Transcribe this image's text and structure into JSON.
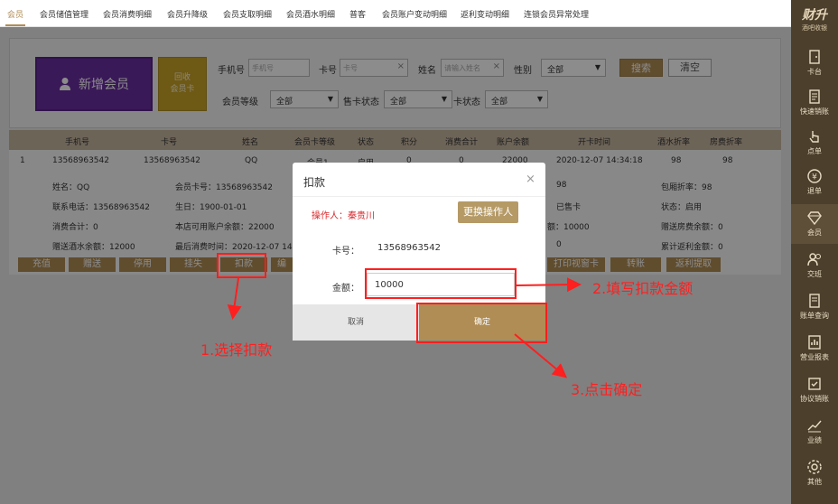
{
  "tabs": [
    {
      "label": "会员",
      "active": true
    },
    {
      "label": "会员储值管理"
    },
    {
      "label": "会员消费明细"
    },
    {
      "label": "会员升降级"
    },
    {
      "label": "会员支取明细"
    },
    {
      "label": "会员酒水明细"
    },
    {
      "label": "普客"
    },
    {
      "label": "会员账户变动明细"
    },
    {
      "label": "返利变动明细"
    },
    {
      "label": "连锁会员异常处理"
    }
  ],
  "search": {
    "new_member_label": "新增会员",
    "recycle_line1": "回收",
    "recycle_line2": "会员卡",
    "phone_label": "手机号",
    "phone_placeholder": "手机号",
    "card_label": "卡号",
    "card_placeholder": "卡号",
    "name_label": "姓名",
    "name_placeholder": "请输入姓名",
    "gender_label": "性别",
    "gender_value": "全部",
    "level_label": "会员等级",
    "level_value": "全部",
    "sale_status_label": "售卡状态",
    "sale_status_value": "全部",
    "card_status_label": "卡状态",
    "card_status_value": "全部",
    "search_btn": "搜索",
    "clear_btn": "清空"
  },
  "table": {
    "headers": [
      "手机号",
      "卡号",
      "姓名",
      "会员卡等级",
      "状态",
      "积分",
      "消费合计",
      "账户余额",
      "开卡时间",
      "酒水折率",
      "房费折率"
    ],
    "row": [
      "1",
      "13568963542",
      "13568963542",
      "QQ",
      "会员1",
      "启用",
      "0",
      "0",
      "22000",
      "2020-12-07 14:34:18",
      "98",
      "98"
    ]
  },
  "detail": {
    "name": "姓名：QQ",
    "card_no": "会员卡号：13568963542",
    "room_discount": "包厢折率：98",
    "phone": "联系电话：13568963542",
    "birthday": "生日：1900-01-01",
    "sold": "已售卡",
    "status": "状态：启用",
    "consume": "消费合计：0",
    "available": "本店可用账户余额：22000",
    "balance_tail": "额：10000",
    "gift_room": "赠送房费余额：0",
    "gift_wine": "赠送酒水余额：12000",
    "last_consume": "最后消费时间：2020-12-07 14:",
    "points_tail": "0",
    "rebate": "累计返利金额：0",
    "extra_98": "98"
  },
  "actions": [
    {
      "label": "充值"
    },
    {
      "label": "赠送"
    },
    {
      "label": "停用"
    },
    {
      "label": "挂失"
    },
    {
      "label": "扣款"
    },
    {
      "label": "编"
    },
    {
      "label": "打印视窗卡"
    },
    {
      "label": "转账"
    },
    {
      "label": "返利提取"
    }
  ],
  "sidebar": {
    "logo": "财升",
    "logo_sub": "酒吧收银",
    "items": [
      {
        "label": "卡台",
        "icon": "door-icon"
      },
      {
        "label": "快速销账",
        "icon": "receipt-icon"
      },
      {
        "label": "点单",
        "icon": "hand-icon"
      },
      {
        "label": "退单",
        "icon": "yen-icon"
      },
      {
        "label": "会员",
        "icon": "diamond-icon",
        "active": true
      },
      {
        "label": "交班",
        "icon": "users-icon"
      },
      {
        "label": "账单查询",
        "icon": "document-icon"
      },
      {
        "label": "营业报表",
        "icon": "report-icon"
      },
      {
        "label": "协议销账",
        "icon": "agreement-icon"
      },
      {
        "label": "业绩",
        "icon": "chart-icon"
      },
      {
        "label": "其他",
        "icon": "gear-icon"
      }
    ]
  },
  "modal": {
    "title": "扣款",
    "close": "×",
    "operator": "操作人：秦贵川",
    "change_operator": "更换操作人",
    "card_label": "卡号：",
    "card_value": "13568963542",
    "amount_label": "金额：",
    "amount_value": "10000",
    "cancel": "取消",
    "ok": "确定"
  },
  "annotations": {
    "step1": "1.选择扣款",
    "step2": "2.填写扣款金额",
    "step3": "3.点击确定",
    "color": "#ff1f1f"
  }
}
